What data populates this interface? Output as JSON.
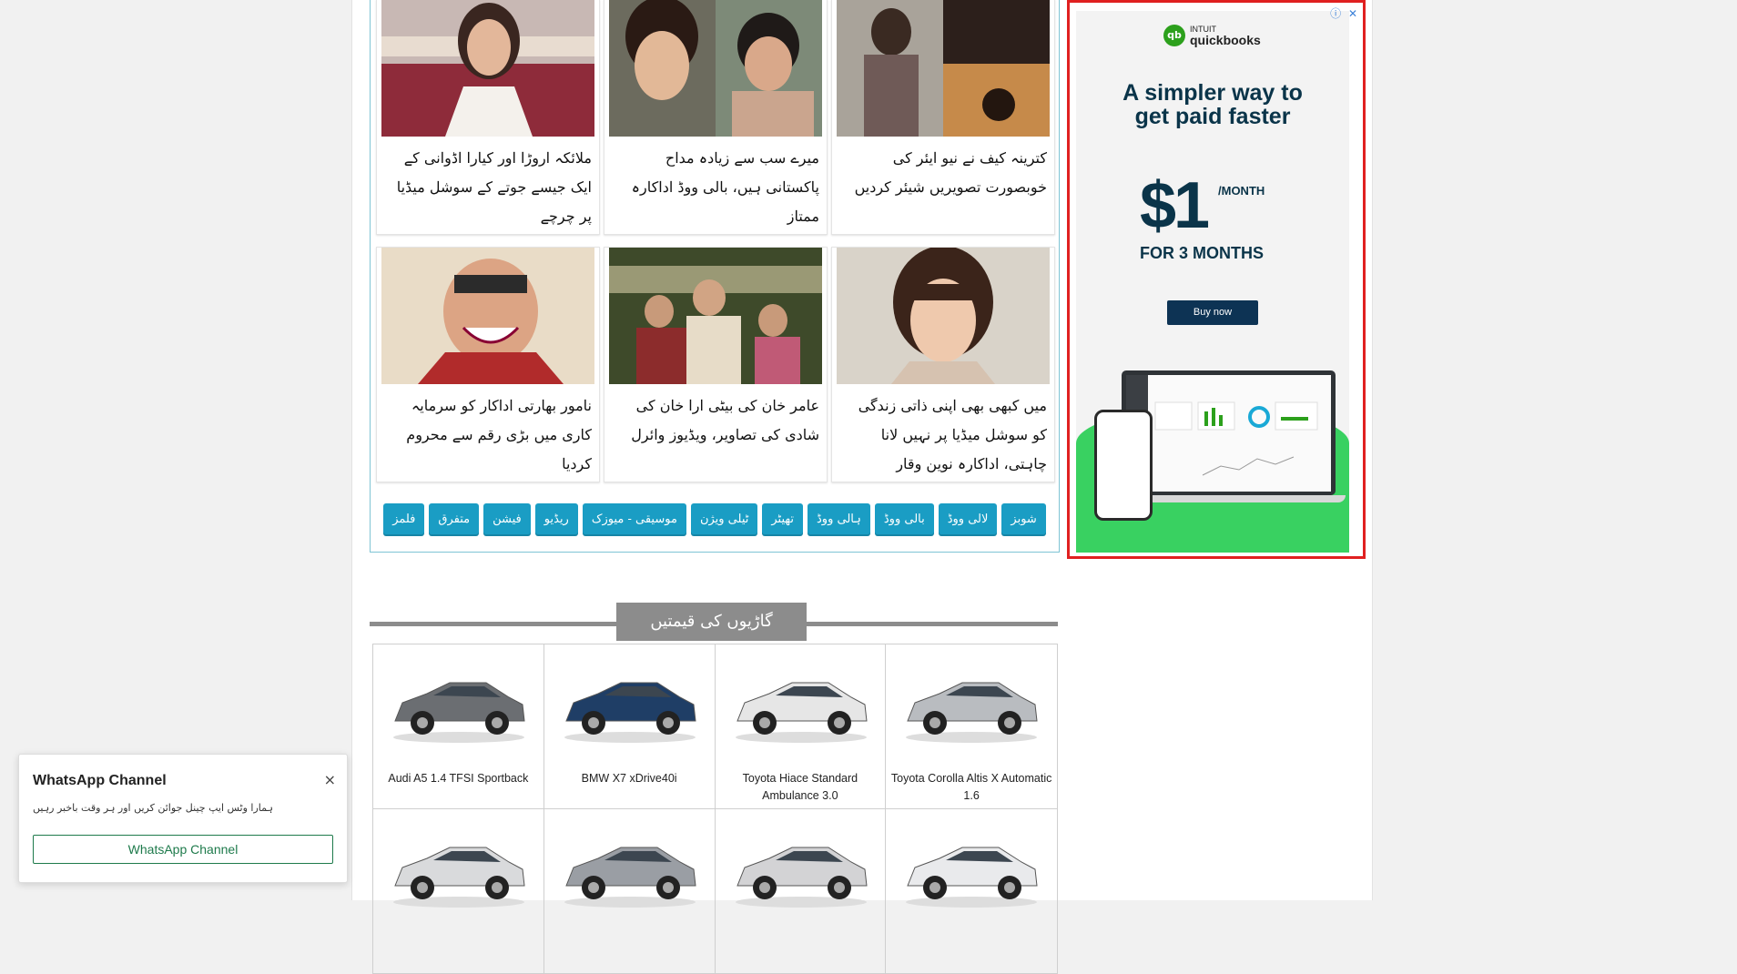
{
  "news": {
    "cards": [
      {
        "title": "ملائکہ اروڑا اور کیارا اڈوانی کے ایک جیسے جوتے کے سوشل میڈیا پر چرچے"
      },
      {
        "title": "میرے سب سے زیادہ مداح پاکستانی ہیں، بالی ووڈ اداکارہ ممتاز"
      },
      {
        "title": "کترینہ کیف نے نیو ایئر کی خوبصورت تصویریں شیئر کردیں"
      },
      {
        "title": "نامور بھارتی اداکار کو سرمایہ کاری میں بڑی رقم سے محروم کردیا"
      },
      {
        "title": "عامر خان کی بیٹی ارا خان کی شادی کی تصاویر، ویڈیوز وائرل"
      },
      {
        "title": "میں کبھی بھی اپنی ذاتی زندگی کو سوشل میڈیا پر نہیں لانا چاہتی، اداکارہ نوین وقار"
      }
    ],
    "categories": [
      "شوبز",
      "لالی ووڈ",
      "بالی ووڈ",
      "ہالی ووڈ",
      "تھیٹر",
      "ٹیلی ویژن",
      "موسیقی - میوزک",
      "ریڈیو",
      "فیشن",
      "متفرق",
      "فلمز"
    ]
  },
  "ad": {
    "brand_small": "INTUIT",
    "brand": "quickbooks",
    "logo_letters": "qb",
    "headline": "A simpler way to get paid faster",
    "price": "$1",
    "per": "/MONTH",
    "duration": "FOR 3 MONTHS",
    "cta": "Buy now",
    "info_icon": "info-icon",
    "close_icon": "close-icon",
    "colors": {
      "brand_green": "#2ca01c",
      "navy": "#0a3449",
      "border": "#e02020"
    }
  },
  "cars": {
    "section_title": "گاڑیوں کی قیمتیں",
    "items": [
      {
        "name": "Audi A5 1.4 TFSI Sportback",
        "color": "#6b6e72"
      },
      {
        "name": "BMW X7 xDrive40i",
        "color": "#1f3e66"
      },
      {
        "name": "Toyota Hiace Standard Ambulance 3.0",
        "color": "#e6e6e6"
      },
      {
        "name": "Toyota Corolla Altis X Automatic 1.6",
        "color": "#b9bcc0"
      },
      {
        "name": "",
        "color": "#d9dadc"
      },
      {
        "name": "",
        "color": "#9a9ea4"
      },
      {
        "name": "",
        "color": "#d3d3d5"
      },
      {
        "name": "",
        "color": "#e9eaec"
      }
    ]
  },
  "toast": {
    "title": "WhatsApp Channel",
    "message": "ہمارا وٹس ایپ چینل جوائن کریں اور ہر وقت باخبر رہیں",
    "button": "WhatsApp Channel",
    "close": "×"
  }
}
